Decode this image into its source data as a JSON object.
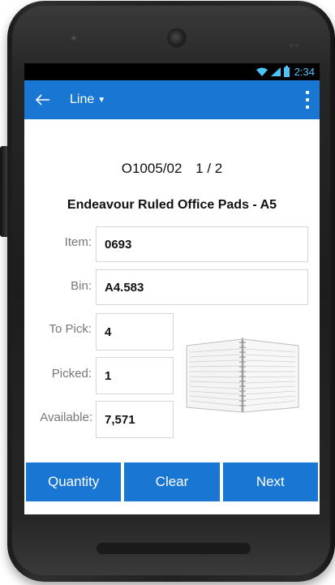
{
  "status_bar": {
    "time": "2:34"
  },
  "app_bar": {
    "title": "Line"
  },
  "order": {
    "number": "O1005/02",
    "position": "1 / 2"
  },
  "product": {
    "name": "Endeavour Ruled Office Pads - A5"
  },
  "fields": {
    "item": {
      "label": "Item:",
      "value": "0693"
    },
    "bin": {
      "label": "Bin:",
      "value": "A4.583"
    },
    "to_pick": {
      "label": "To Pick:",
      "value": "4"
    },
    "picked": {
      "label": "Picked:",
      "value": "1"
    },
    "available": {
      "label": "Available:",
      "value": "7,571"
    }
  },
  "buttons": {
    "quantity": "Quantity",
    "clear": "Clear",
    "next": "Next"
  },
  "colors": {
    "accent": "#1976d2",
    "status_accent": "#4fc3f7"
  }
}
